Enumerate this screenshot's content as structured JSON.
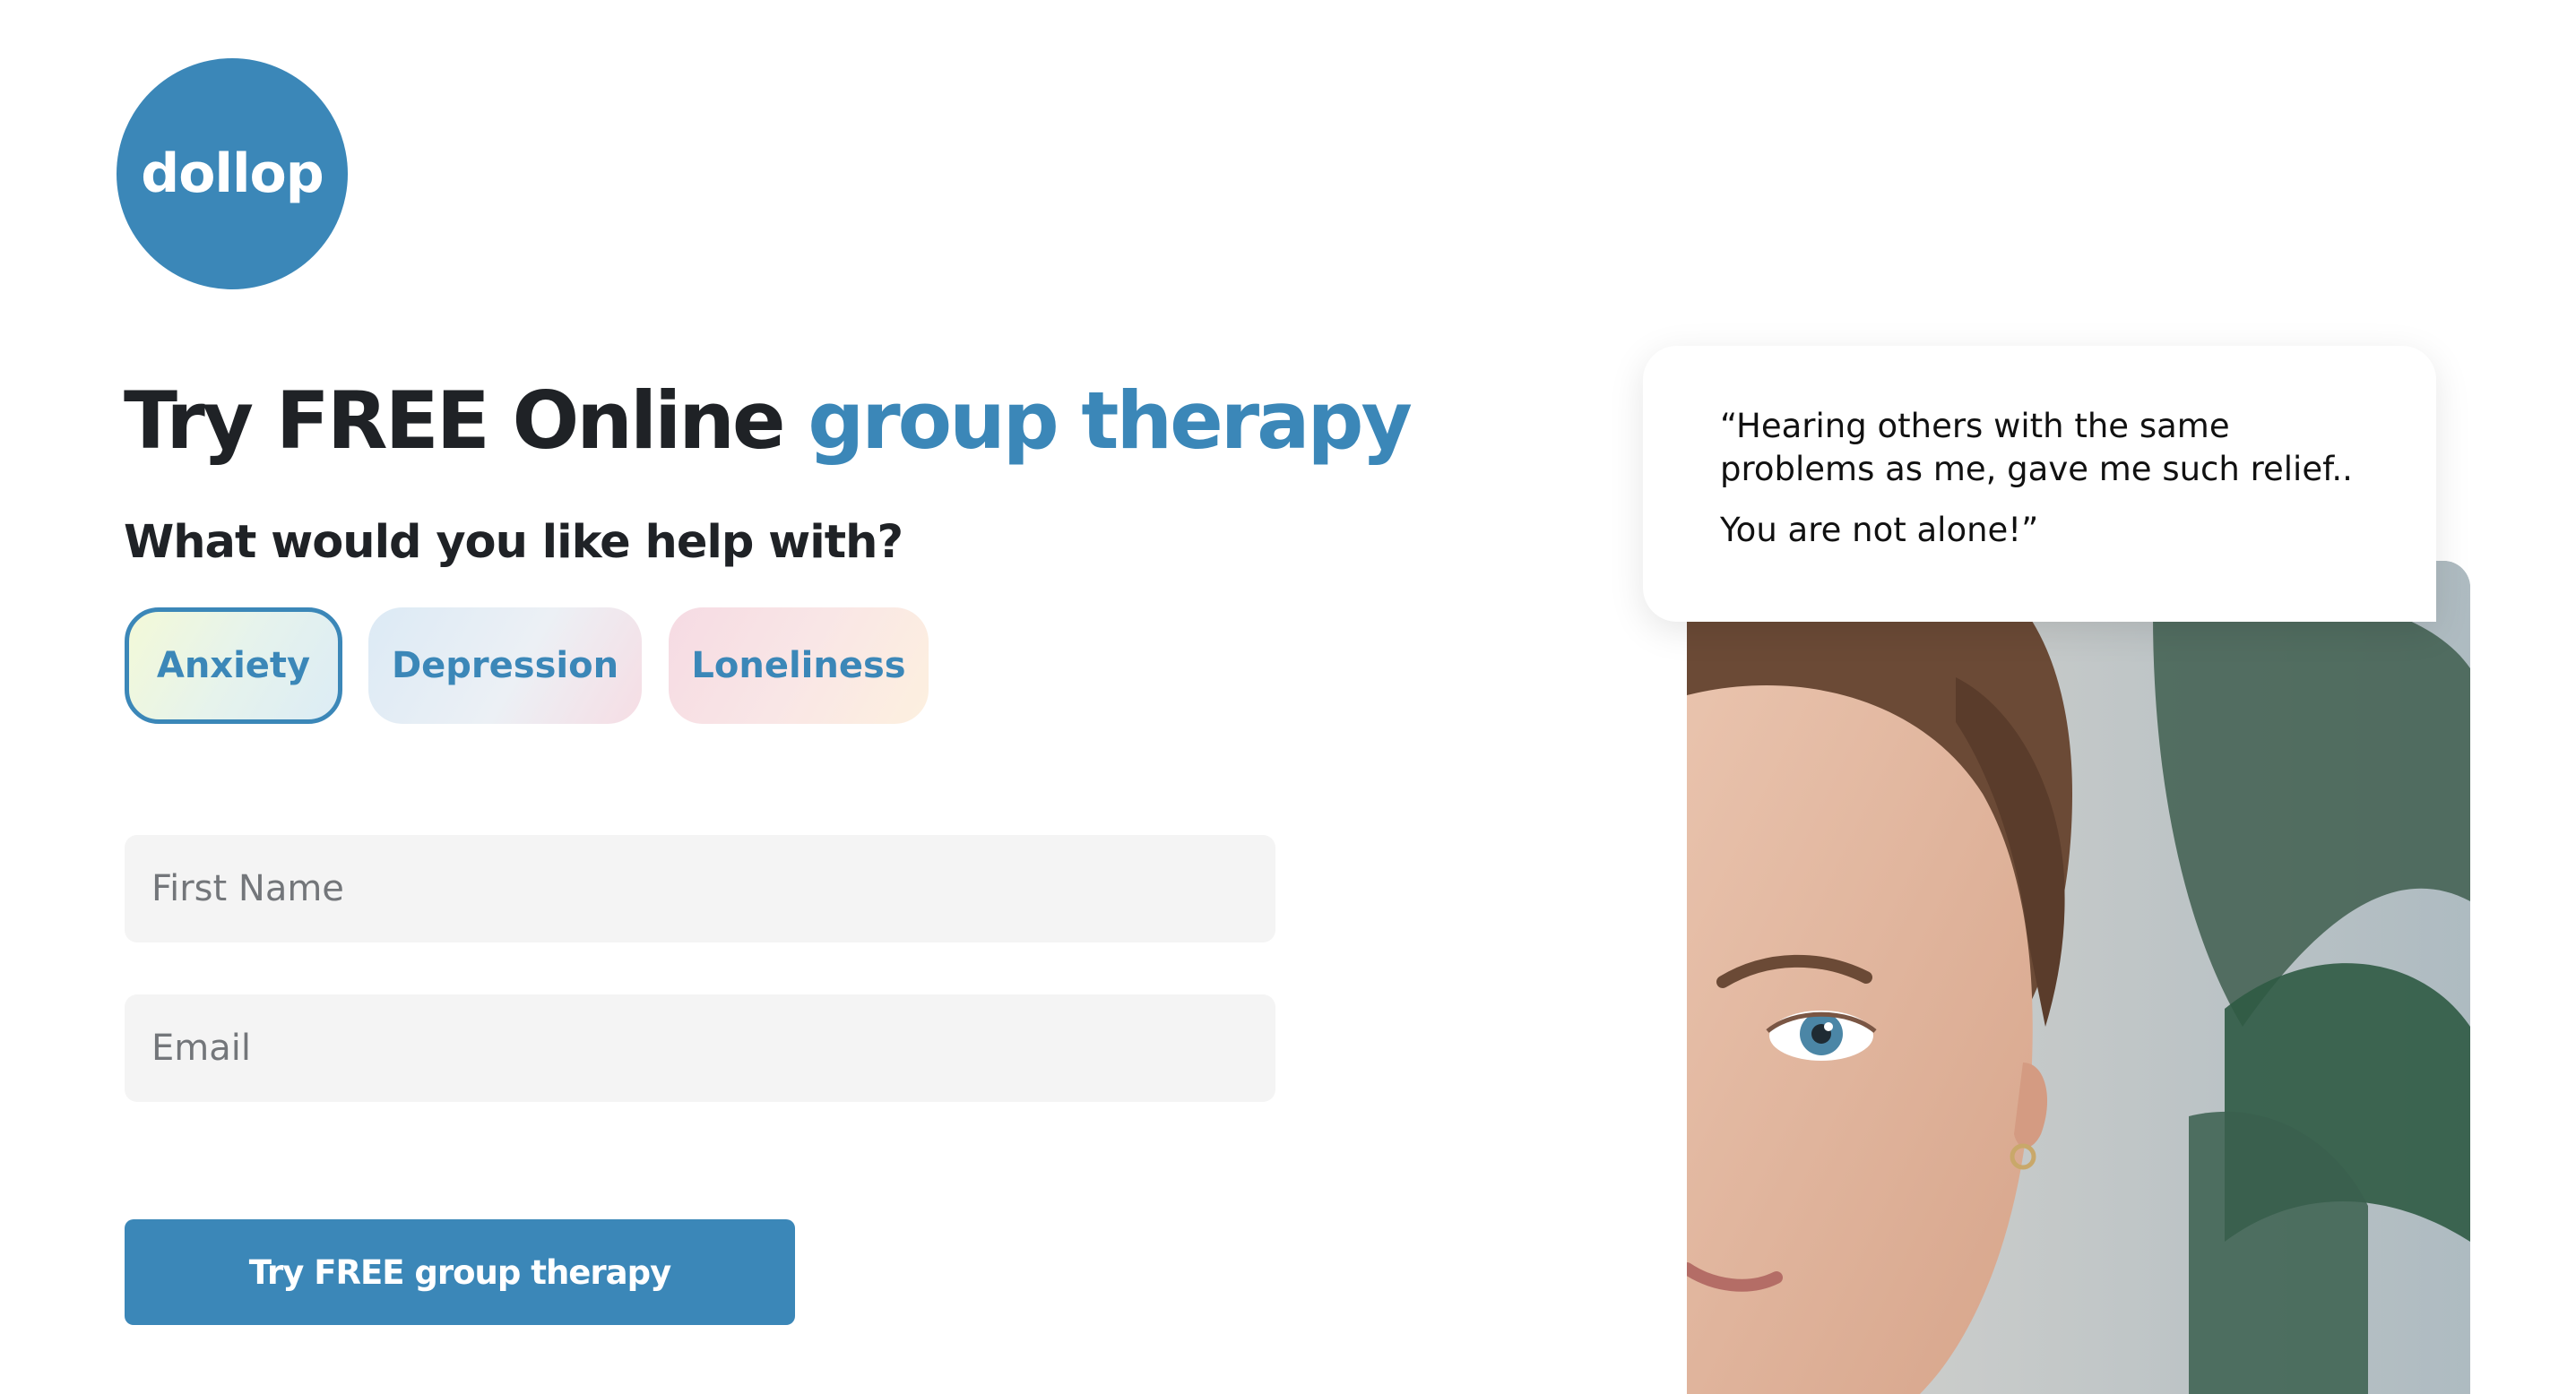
{
  "brand": {
    "logo_text": "dollop",
    "accent_color": "#3b87b8"
  },
  "hero": {
    "headline_prefix": "Try FREE Online ",
    "headline_accent": "group therapy",
    "question": "What would you like help with?"
  },
  "topics": [
    {
      "label": "Anxiety",
      "selected": true
    },
    {
      "label": "Depression",
      "selected": false
    },
    {
      "label": "Loneliness",
      "selected": false
    }
  ],
  "form": {
    "first_name_placeholder": "First Name",
    "first_name_value": "",
    "email_placeholder": "Email",
    "email_value": "",
    "submit_label": "Try FREE group therapy"
  },
  "testimonial": {
    "line1": "“Hearing others with the same problems as me, gave me such relief..",
    "line2": "You are not alone!”"
  }
}
